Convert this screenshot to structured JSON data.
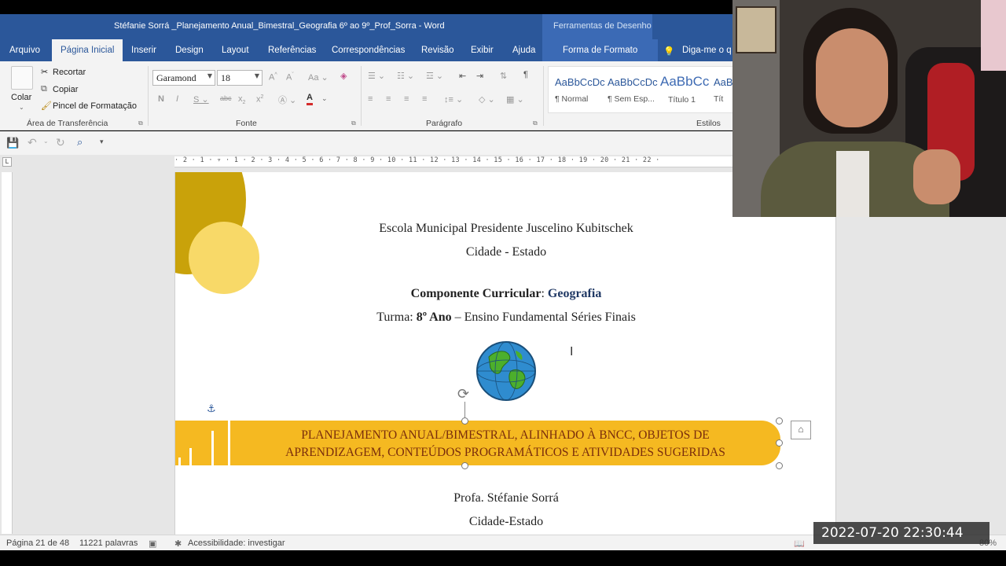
{
  "titlebar": {
    "title": "Stéfanie Sorrá _Planejamento Anual_Bimestral_Geografia 6º ao 9º_Prof_Sorra  -  Word",
    "contextual_tab": "Ferramentas de Desenho"
  },
  "tabs": {
    "arquivo": "Arquivo",
    "pagina_inicial": "Página Inicial",
    "inserir": "Inserir",
    "design": "Design",
    "layout": "Layout",
    "referencias": "Referências",
    "correspondencias": "Correspondências",
    "revisao": "Revisão",
    "exibir": "Exibir",
    "ajuda": "Ajuda",
    "forma_de_formato": "Forma de Formato",
    "tell_me": "Diga-me o q"
  },
  "ribbon": {
    "clipboard": {
      "paste": "Colar",
      "cut": "Recortar",
      "copy": "Copiar",
      "format_painter": "Pincel de Formatação",
      "label": "Área de Transferência"
    },
    "font": {
      "family": "Garamond",
      "size": "18",
      "label": "Fonte"
    },
    "paragraph": {
      "label": "Parágrafo"
    },
    "styles": {
      "label": "Estilos",
      "items": [
        {
          "sample": "AaBbCcDc",
          "name": "¶ Normal"
        },
        {
          "sample": "AaBbCcDc",
          "name": "¶ Sem Esp..."
        },
        {
          "sample": "AaBbCc",
          "name": "Título 1"
        },
        {
          "sample": "AaB",
          "name": "Tít"
        }
      ]
    }
  },
  "ruler": {
    "horizontal": "· 2 · 1 · ▿ · 1 · 2 · 3 · 4 · 5 · 6 · 7 · 8 · 9 · 10 · 11 · 12 · 13 · 14 · 15 · 16 · 17 · 18 · 19 · 20 · 21 · 22 ·",
    "corner": "L"
  },
  "document": {
    "school": "Escola Municipal Presidente Juscelino Kubitschek",
    "city_state": "Cidade - Estado",
    "component_label": "Componente Curricular",
    "component_sep": ": ",
    "component_value": "Geografia",
    "class_label": "Turma: ",
    "class_value": "8º Ano",
    "class_rest": " – Ensino Fundamental Séries Finais",
    "banner_line1": "PLANEJAMENTO ANUAL/BIMESTRAL, ALINHADO À BNCC, OBJETOS DE",
    "banner_line2": "APRENDIZAGEM, CONTEÚDOS PROGRAMÁTICOS E ATIVIDADES SUGERIDAS",
    "teacher": "Profa. Stéfanie Sorrá",
    "city_state2": "Cidade-Estado",
    "banner_color": "#f5b921",
    "accent_dark_circle": "#c9a20a",
    "accent_light_circle": "#f8d968"
  },
  "statusbar": {
    "page": "Página 21 de 48",
    "words": "11221 palavras",
    "accessibility": "Acessibilidade: investigar",
    "zoom": "80%"
  },
  "overlay": {
    "timestamp": "2022-07-20  22:30:44"
  },
  "colors": {
    "word_blue": "#2b579a",
    "ribbon_bg": "#f3f3f3"
  }
}
